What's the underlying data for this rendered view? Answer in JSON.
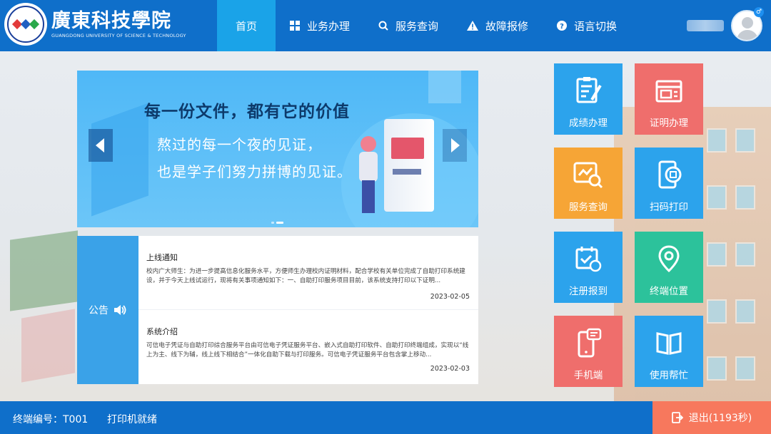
{
  "header": {
    "school_cn": "廣東科技學院",
    "school_en": "GUANGDONG UNIVERSITY OF SCIENCE & TECHNOLOGY",
    "nav": [
      {
        "label": "首页",
        "icon": "home"
      },
      {
        "label": "业务办理",
        "icon": "grid-icon"
      },
      {
        "label": "服务查询",
        "icon": "search-icon"
      },
      {
        "label": "故障报修",
        "icon": "warning-icon"
      },
      {
        "label": "语言切换",
        "icon": "help-icon"
      }
    ],
    "gender_symbol": "♂"
  },
  "banner": {
    "title": "每一份文件，都有它的价值",
    "line1": "熬过的每一个夜的见证，",
    "line2": "也是学子们努力拼博的见证。"
  },
  "notices": {
    "tag": "公告",
    "items": [
      {
        "title": "上线通知",
        "body": "校内广大师生：为进一步提高信息化服务水平，方便师生办理校内证明材料，配合学校有关单位完成了自助打印系统建设，并于今天上线试运行，现将有关事项通知如下：一、自助打印服务项目目前，该系统支持打印以下证明...",
        "date": "2023-02-05"
      },
      {
        "title": "系统介绍",
        "body": "可信电子凭证与自助打印综合服务平台由可信电子凭证服务平台、嵌入式自助打印软件、自助打印终端组成，实现以“线上为主、线下为辅，线上线下相结合”一体化自助下载与打印服务。可信电子凭证服务平台包含掌上移动...",
        "date": "2023-02-03"
      }
    ]
  },
  "tiles": [
    {
      "label": "成绩办理",
      "icon": "grade-doc-icon",
      "color": "#2ca3ec"
    },
    {
      "label": "证明办理",
      "icon": "certificate-icon",
      "color": "#ef6e6c"
    },
    {
      "label": "服务查询",
      "icon": "service-search-icon",
      "color": "#f6a536"
    },
    {
      "label": "扫码打印",
      "icon": "scan-print-icon",
      "color": "#2ca3ec"
    },
    {
      "label": "注册报到",
      "icon": "register-icon",
      "color": "#2ca3ec"
    },
    {
      "label": "终端位置",
      "icon": "location-icon",
      "color": "#2cc29b"
    },
    {
      "label": "手机端",
      "icon": "mobile-icon",
      "color": "#ef6e6c"
    },
    {
      "label": "使用帮忙",
      "icon": "help-book-icon",
      "color": "#2ca3ec"
    }
  ],
  "footer": {
    "terminal_id": "终端编号：T001",
    "status": "打印机就绪",
    "exit_label": "退出(1193秒)"
  }
}
